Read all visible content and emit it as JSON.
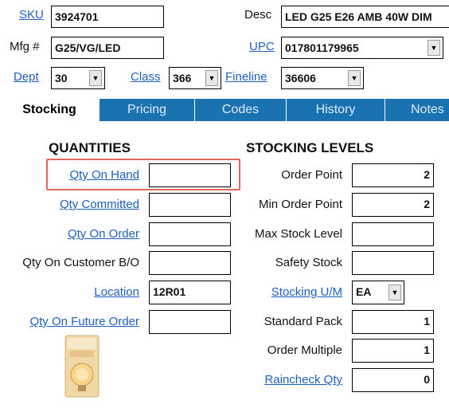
{
  "header": {
    "sku": {
      "label": "SKU",
      "value": "3924701"
    },
    "desc": {
      "label": "Desc",
      "value": "LED G25 E26 AMB 40W DIM"
    },
    "mfg": {
      "label": "Mfg #",
      "value": "G25/VG/LED"
    },
    "upc": {
      "label": "UPC",
      "value": "017801179965"
    },
    "dept": {
      "label": "Dept",
      "value": "30"
    },
    "class": {
      "label": "Class",
      "value": "366"
    },
    "fineline": {
      "label": "Fineline",
      "value": "36606"
    }
  },
  "tabs": [
    "Stocking",
    "Pricing",
    "Codes",
    "History",
    "Notes"
  ],
  "active_tab": "Stocking",
  "quantities": {
    "heading": "QUANTITIES",
    "qty_on_hand": {
      "label": "Qty On Hand",
      "value": ""
    },
    "qty_committed": {
      "label": "Qty Committed",
      "value": ""
    },
    "qty_on_order": {
      "label": "Qty On Order",
      "value": ""
    },
    "qty_customer_bo": {
      "label": "Qty On Customer B/O",
      "value": ""
    },
    "location": {
      "label": "Location",
      "value": "12R01"
    },
    "qty_future_order": {
      "label": "Qty On Future Order",
      "value": ""
    }
  },
  "stocking_levels": {
    "heading": "STOCKING LEVELS",
    "order_point": {
      "label": "Order Point",
      "value": "2"
    },
    "min_order_point": {
      "label": "Min Order Point",
      "value": "2"
    },
    "max_stock_level": {
      "label": "Max Stock Level",
      "value": ""
    },
    "safety_stock": {
      "label": "Safety Stock",
      "value": ""
    },
    "stocking_um": {
      "label": "Stocking U/M",
      "value": "EA"
    },
    "standard_pack": {
      "label": "Standard Pack",
      "value": "1"
    },
    "order_multiple": {
      "label": "Order Multiple",
      "value": "1"
    },
    "raincheck_qty": {
      "label": "Raincheck Qty",
      "value": "0"
    }
  },
  "icons": {
    "dropdown": "chevron-down-icon",
    "product": "product-image"
  },
  "colors": {
    "tab_bar": "#1b72b0",
    "link": "#1f5fbf",
    "highlight": "#e06a60"
  }
}
